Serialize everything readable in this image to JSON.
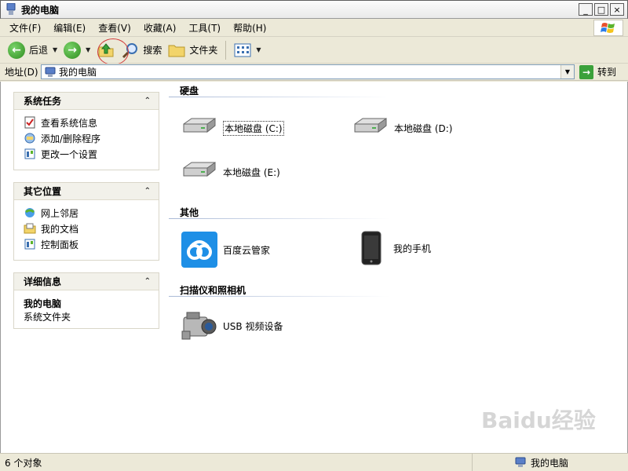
{
  "window": {
    "title": "我的电脑"
  },
  "menu": [
    "文件(F)",
    "编辑(E)",
    "查看(V)",
    "收藏(A)",
    "工具(T)",
    "帮助(H)"
  ],
  "toolbar": {
    "back_label": "后退",
    "search_label": "搜索",
    "folders_label": "文件夹"
  },
  "address": {
    "label": "地址(D)",
    "value": "我的电脑",
    "go_label": "转到"
  },
  "left_panels": {
    "system_tasks": {
      "title": "系统任务",
      "items": [
        "查看系统信息",
        "添加/删除程序",
        "更改一个设置"
      ]
    },
    "other_places": {
      "title": "其它位置",
      "items": [
        "网上邻居",
        "我的文档",
        "控制面板"
      ]
    },
    "details": {
      "title": "详细信息",
      "name": "我的电脑",
      "type": "系统文件夹"
    }
  },
  "groups": {
    "hard_disks": {
      "title": "硬盘",
      "items": [
        "本地磁盘 (C:)",
        "本地磁盘 (D:)",
        "本地磁盘 (E:)"
      ]
    },
    "other": {
      "title": "其他",
      "items": [
        "百度云管家",
        "我的手机"
      ]
    },
    "scanners": {
      "title": "扫描仪和照相机",
      "items": [
        "USB 视频设备"
      ]
    }
  },
  "status": {
    "count": "6 个对象",
    "location": "我的电脑"
  },
  "watermark": "Baidu经验"
}
